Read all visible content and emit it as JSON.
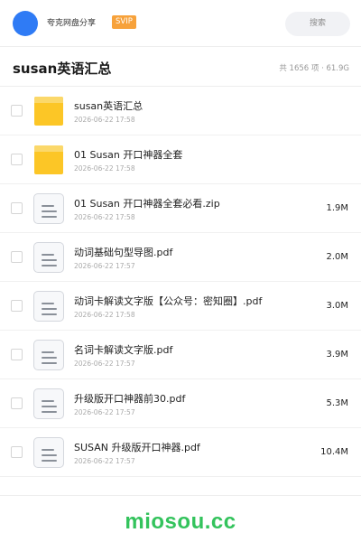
{
  "header": {
    "username": "夸克网盘分享",
    "badge": "SVIP",
    "search_label": "搜索"
  },
  "folder": {
    "title": "susan英语汇总",
    "summary": "共 1656 项 · 61.9G"
  },
  "files": [
    {
      "name": "susan英语汇总",
      "date": "2026-06-22 17:58",
      "size": "",
      "icon": "folder-icon"
    },
    {
      "name": "01 Susan 开口神器全套",
      "date": "2026-06-22 17:58",
      "size": "",
      "icon": "folder-icon"
    },
    {
      "name": "01 Susan 开口神器全套必看.zip",
      "date": "2026-06-22 17:58",
      "size": "1.9M",
      "icon": "file-icon"
    },
    {
      "name": "动词基础句型导图.pdf",
      "date": "2026-06-22 17:57",
      "size": "2.0M",
      "icon": "file-icon"
    },
    {
      "name": "动词卡解读文字版【公众号：密知圈】.pdf",
      "date": "2026-06-22 17:58",
      "size": "3.0M",
      "icon": "file-icon"
    },
    {
      "name": "名词卡解读文字版.pdf",
      "date": "2026-06-22 17:57",
      "size": "3.9M",
      "icon": "file-icon"
    },
    {
      "name": "升级版开口神器前30.pdf",
      "date": "2026-06-22 17:57",
      "size": "5.3M",
      "icon": "file-icon"
    },
    {
      "name": "SUSAN 升级版开口神器.pdf",
      "date": "2026-06-22 17:57",
      "size": "10.4M",
      "icon": "file-icon"
    }
  ],
  "watermark": "miosou.cc",
  "colors": {
    "accent": "#2f7bf5",
    "badge": "#f7a23b",
    "folder": "#fcc626",
    "watermark": "#33c35c"
  }
}
